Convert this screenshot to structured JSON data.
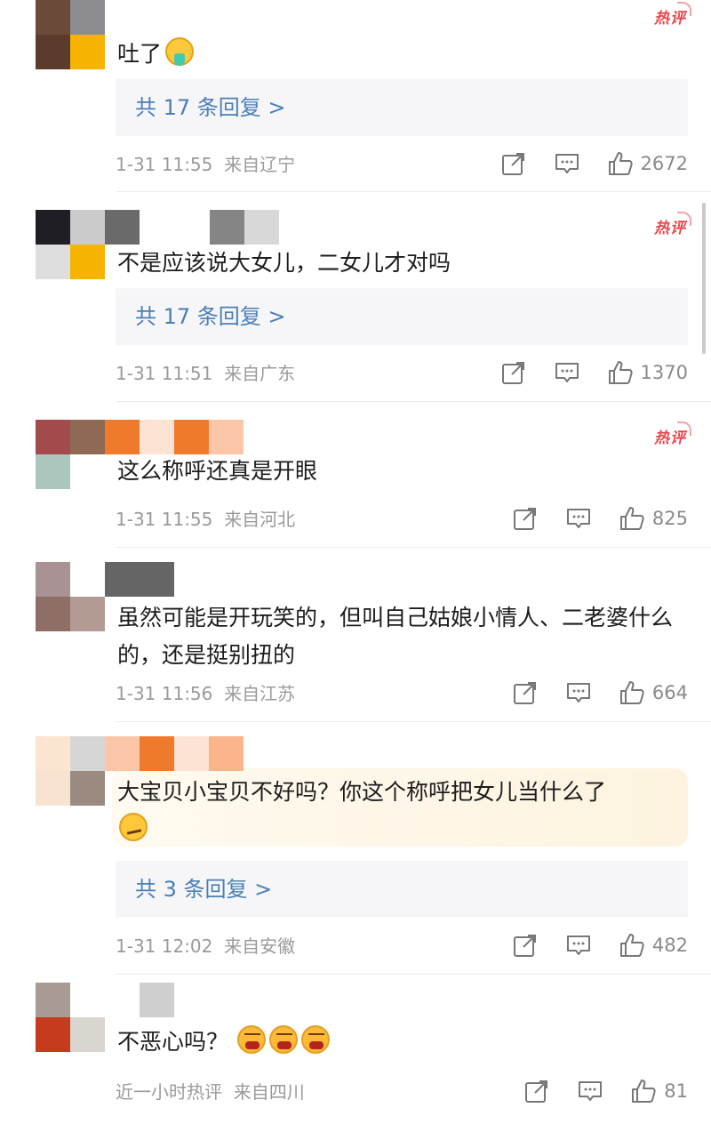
{
  "comments": [
    {
      "badge": "热评",
      "text": "吐了",
      "emoji": [
        "vomit"
      ],
      "replies": "共 17 条回复 >",
      "time": "1-31 11:55",
      "location": "来自辽宁",
      "likes": "2672"
    },
    {
      "badge": "热评",
      "text": "不是应该说大女儿，二女儿才对吗",
      "replies": "共 17 条回复 >",
      "time": "1-31 11:51",
      "location": "来自广东",
      "likes": "1370"
    },
    {
      "badge": "热评",
      "text": "这么称呼还真是开眼",
      "time": "1-31 11:55",
      "location": "来自河北",
      "likes": "825"
    },
    {
      "text": "虽然可能是开玩笑的，但叫自己姑娘小情人、二老婆什么的，还是挺别扭的",
      "time": "1-31 11:56",
      "location": "来自江苏",
      "likes": "664"
    },
    {
      "text": "大宝贝小宝贝不好吗？你这个称呼把女儿当什么了",
      "emoji": [
        "smirk"
      ],
      "replies": "共 3 条回复 >",
      "time": "1-31 12:02",
      "location": "来自安徽",
      "likes": "482"
    },
    {
      "text": "不恶心吗？",
      "emoji": [
        "angry",
        "angry",
        "angry"
      ],
      "time": "近一小时热评",
      "location": "来自四川",
      "likes": "81"
    }
  ],
  "icons": {
    "share": "share-icon",
    "comment": "comment-icon",
    "like": "like-icon"
  },
  "colors": {
    "hot_badge": "#e8474c",
    "reply_link": "#4a7fb8",
    "meta": "#9a9a9a"
  }
}
